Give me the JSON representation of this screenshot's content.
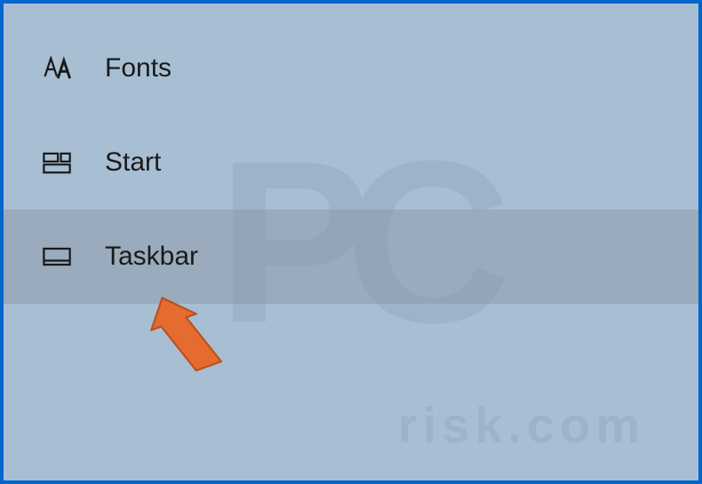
{
  "sidebar": {
    "items": [
      {
        "label": "Fonts"
      },
      {
        "label": "Start"
      },
      {
        "label": "Taskbar"
      }
    ]
  },
  "selected_index": 2,
  "watermark": {
    "main": "PC",
    "sub": "risk.com"
  },
  "annotation": {
    "arrow_color": "#e56b2e"
  }
}
